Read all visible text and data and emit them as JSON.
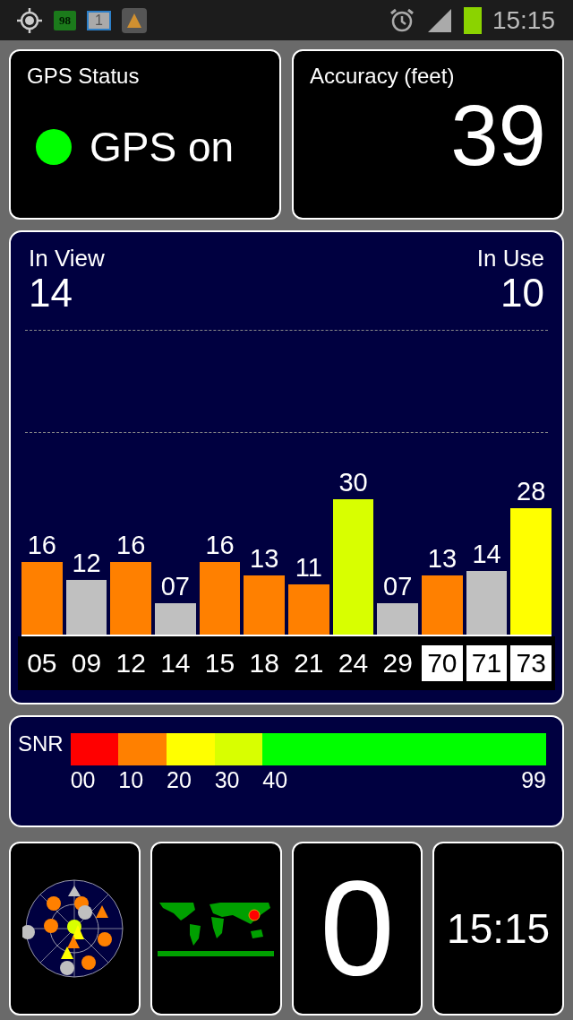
{
  "status_bar": {
    "battery_badge": "98",
    "notification_count": "1",
    "time": "15:15"
  },
  "gps_status": {
    "title": "GPS Status",
    "value": "GPS on",
    "on": true
  },
  "accuracy": {
    "title": "Accuracy (feet)",
    "value": "39"
  },
  "sky": {
    "in_view_label": "In View",
    "in_view": "14",
    "in_use_label": "In Use",
    "in_use": "10",
    "satellites": [
      {
        "prn": "05",
        "snr": "16",
        "color": "#ff8000",
        "boxed": false
      },
      {
        "prn": "09",
        "snr": "12",
        "color": "#c0c0c0",
        "boxed": false
      },
      {
        "prn": "12",
        "snr": "16",
        "color": "#ff8000",
        "boxed": false
      },
      {
        "prn": "14",
        "snr": "07",
        "color": "#c0c0c0",
        "boxed": false
      },
      {
        "prn": "15",
        "snr": "16",
        "color": "#ff8000",
        "boxed": false
      },
      {
        "prn": "18",
        "snr": "13",
        "color": "#ff8000",
        "boxed": false
      },
      {
        "prn": "21",
        "snr": "11",
        "color": "#ff8000",
        "boxed": false
      },
      {
        "prn": "24",
        "snr": "30",
        "color": "#d8ff00",
        "boxed": false
      },
      {
        "prn": "29",
        "snr": "07",
        "color": "#c0c0c0",
        "boxed": false
      },
      {
        "prn": "70",
        "snr": "13",
        "color": "#ff8000",
        "boxed": true
      },
      {
        "prn": "71",
        "snr": "14",
        "color": "#c0c0c0",
        "boxed": true
      },
      {
        "prn": "73",
        "snr": "28",
        "color": "#ffff00",
        "boxed": true
      }
    ]
  },
  "snr_legend": {
    "title": "SNR",
    "segments": [
      {
        "label": "00",
        "color": "#ff0000"
      },
      {
        "label": "10",
        "color": "#ff8000"
      },
      {
        "label": "20",
        "color": "#ffff00"
      },
      {
        "label": "30",
        "color": "#d8ff00"
      },
      {
        "label": "40",
        "color": "#00ff00"
      }
    ],
    "end_label": "99"
  },
  "speed": {
    "value": "0"
  },
  "clock": {
    "time": "15:15"
  }
}
